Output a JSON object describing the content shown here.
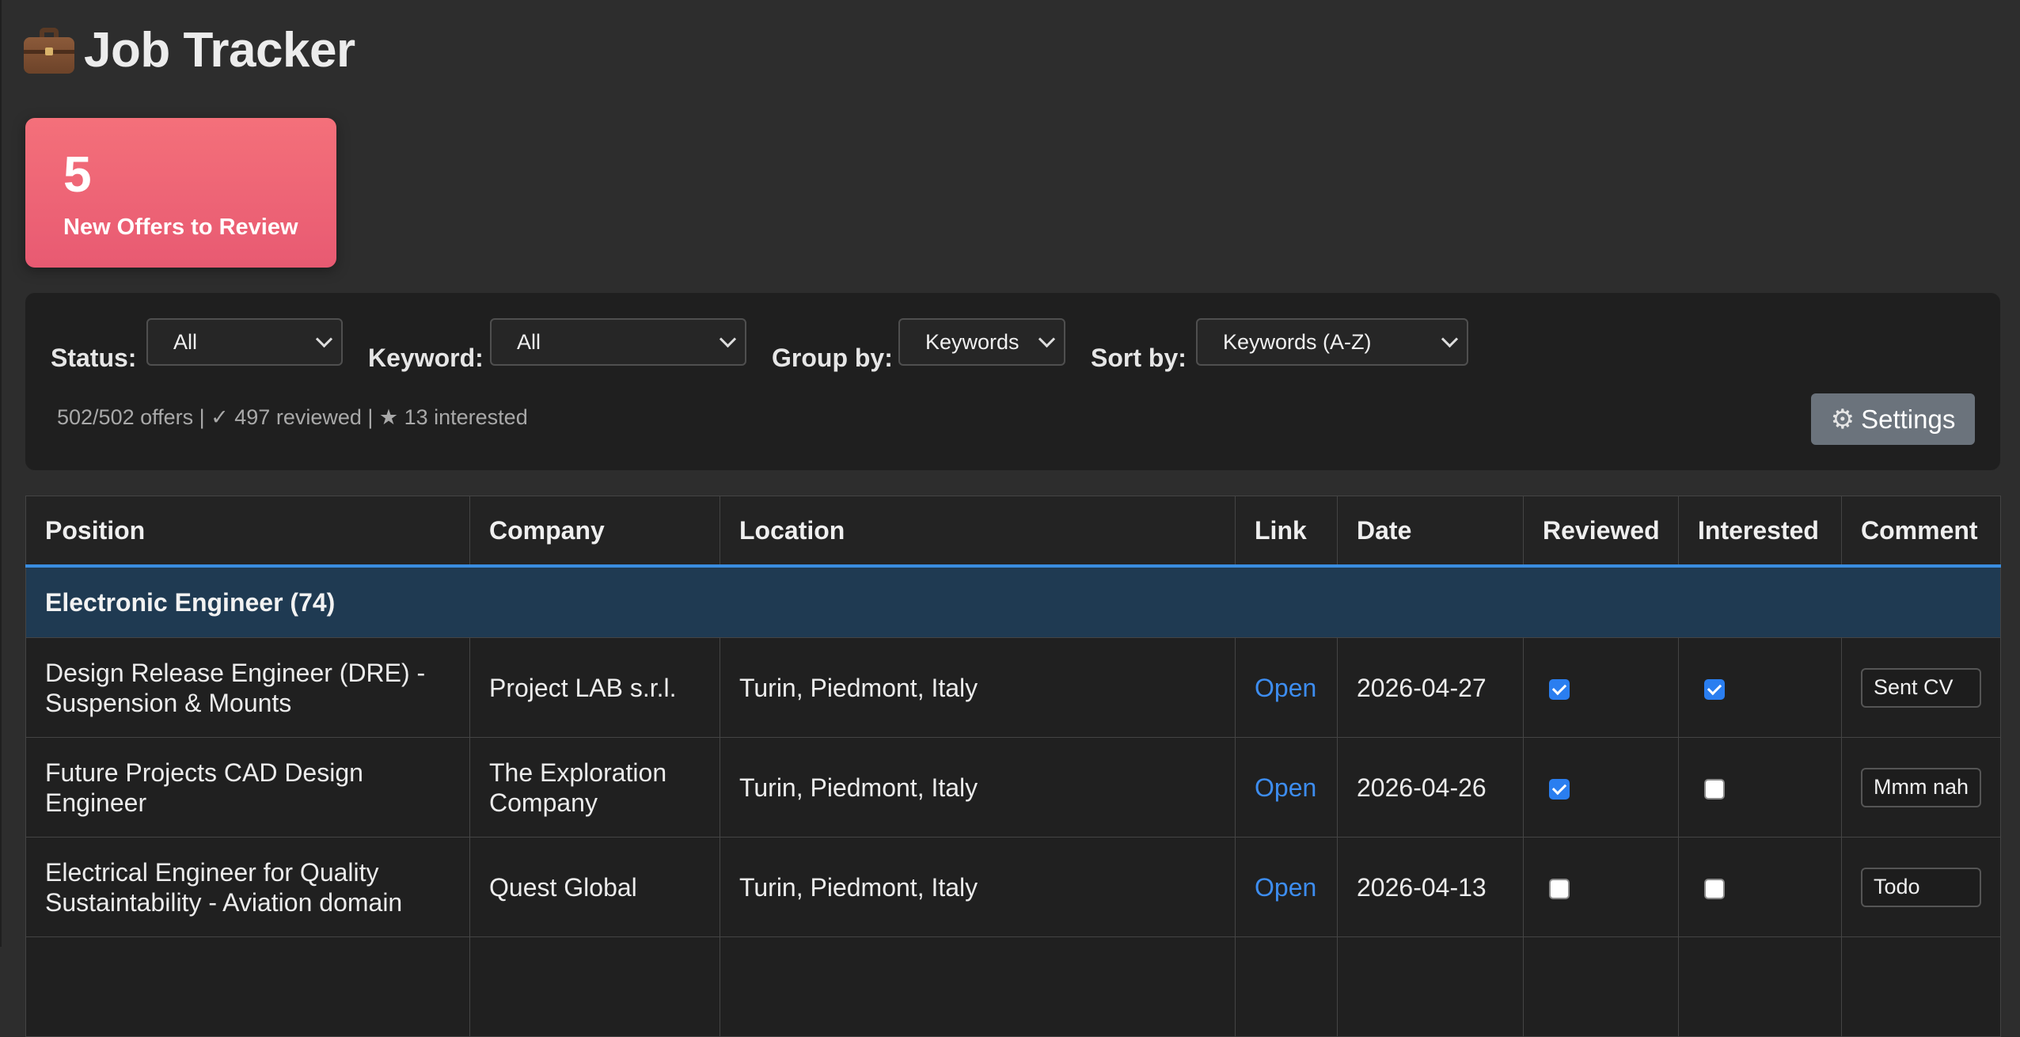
{
  "app": {
    "title": "Job Tracker",
    "icon": "briefcase-icon"
  },
  "stats": {
    "new_offers_count": "5",
    "new_offers_label": "New Offers to Review"
  },
  "filters": {
    "status_label": "Status:",
    "status_value": "All",
    "keyword_label": "Keyword:",
    "keyword_value": "All",
    "group_by_label": "Group by:",
    "group_by_value": "Keywords",
    "sort_by_label": "Sort by:",
    "sort_by_value": "Keywords (A-Z)",
    "summary": "502/502 offers | ✓ 497 reviewed | ★ 13 interested",
    "settings_label": "Settings",
    "settings_icon": "gear-icon"
  },
  "table": {
    "headers": [
      "Position",
      "Company",
      "Location",
      "Link",
      "Date",
      "Reviewed",
      "Interested",
      "Comment"
    ],
    "group_label": "Electronic Engineer (74)",
    "rows": [
      {
        "position": "Design Release Engineer (DRE) - Suspension & Mounts",
        "company": "Project LAB s.r.l.",
        "location": "Turin, Piedmont, Italy",
        "link": "Open",
        "date": "2026-04-27",
        "reviewed": true,
        "interested": true,
        "comment": "Sent CV"
      },
      {
        "position": "Future Projects CAD Design Engineer",
        "company": "The Exploration Company",
        "location": "Turin, Piedmont, Italy",
        "link": "Open",
        "date": "2026-04-26",
        "reviewed": true,
        "interested": false,
        "comment": "Mmm nah"
      },
      {
        "position": "Electrical Engineer for Quality Sustaintability - Aviation domain",
        "company": "Quest Global",
        "location": "Turin, Piedmont, Italy",
        "link": "Open",
        "date": "2026-04-13",
        "reviewed": false,
        "interested": false,
        "comment": "Todo"
      }
    ]
  },
  "colors": {
    "background": "#2d2d2d",
    "panel": "#1f1f1f",
    "card_gradient_top": "#f4707a",
    "card_gradient_bottom": "#e85a72",
    "accent_blue": "#3a8de0",
    "group_row": "#1f3a52",
    "link": "#3d8df0",
    "settings_button": "#6b737c"
  }
}
